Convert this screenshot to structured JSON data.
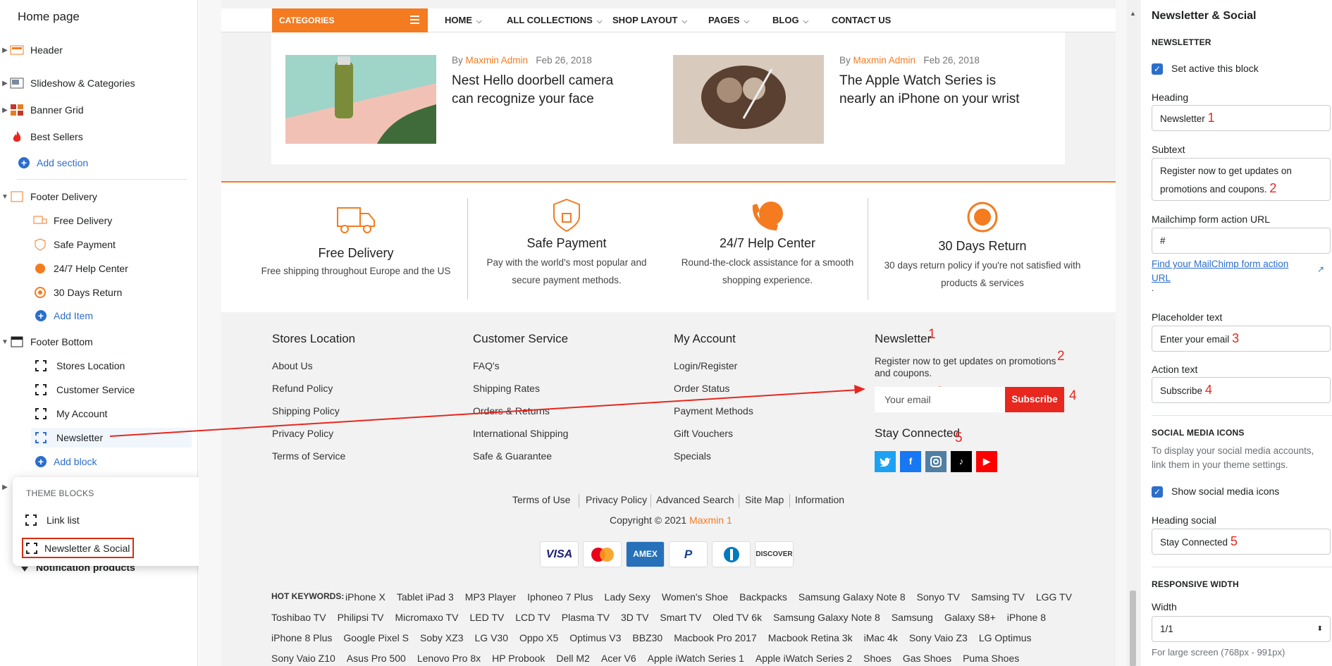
{
  "sidebar": {
    "title": "Home page",
    "sections": [
      {
        "label": "Header"
      },
      {
        "label": "Slideshow & Categories"
      },
      {
        "label": "Banner Grid"
      },
      {
        "label": "Best Sellers"
      }
    ],
    "add_section": "Add section",
    "footer_delivery": {
      "label": "Footer Delivery",
      "items": [
        "Free Delivery",
        "Safe Payment",
        "24/7 Help Center",
        "30 Days Return"
      ],
      "add_item": "Add Item"
    },
    "footer_bottom": {
      "label": "Footer Bottom",
      "blocks": [
        "Stores Location",
        "Customer Service",
        "My Account",
        "Newsletter"
      ],
      "add_block": "Add block"
    },
    "hidden_row": "Notification products",
    "popup": {
      "heading": "THEME BLOCKS",
      "items": [
        "Link list",
        "Newsletter & Social"
      ]
    }
  },
  "preview": {
    "nav": {
      "categories": "CATEGORIES",
      "items": [
        "HOME",
        "ALL COLLECTIONS",
        "SHOP LAYOUT",
        "PAGES",
        "BLOG",
        "CONTACT US"
      ]
    },
    "posts": [
      {
        "by": "By",
        "author": "Maxmin Admin",
        "date": "Feb 26, 2018",
        "title": "Nest Hello doorbell camera can recognize your face"
      },
      {
        "by": "By",
        "author": "Maxmin Admin",
        "date": "Feb 26, 2018",
        "title": "The Apple Watch Series is nearly an iPhone on your wrist"
      }
    ],
    "features": [
      {
        "title": "Free Delivery",
        "desc": "Free shipping throughout Europe and the US"
      },
      {
        "title": "Safe Payment",
        "desc": "Pay with the world's most popular and secure payment methods."
      },
      {
        "title": "24/7 Help Center",
        "desc": "Round-the-clock assistance for a smooth shopping experience."
      },
      {
        "title": "30 Days Return",
        "desc": "30 days return policy if you're not satisfied with products & services"
      }
    ],
    "footer": {
      "stores": {
        "heading": "Stores Location",
        "links": [
          "About Us",
          "Refund Policy",
          "Shipping Policy",
          "Privacy Policy",
          "Terms of Service"
        ]
      },
      "service": {
        "heading": "Customer Service",
        "links": [
          "FAQ's",
          "Shipping Rates",
          "Orders & Returns",
          "International Shipping",
          "Safe & Guarantee"
        ]
      },
      "account": {
        "heading": "My Account",
        "links": [
          "Login/Register",
          "Order Status",
          "Payment Methods",
          "Gift Vouchers",
          "Specials"
        ]
      },
      "newsletter": {
        "heading": "Newsletter",
        "subtext": "Register now to get updates on promotions and coupons.",
        "placeholder": "Your email",
        "button": "Subscribe",
        "social_heading": "Stay Connected"
      },
      "bottom_links": [
        "Terms of Use",
        "Privacy Policy",
        "Advanced Search",
        "Site Map",
        "Information"
      ],
      "copyright_prefix": "Copyright © 2021",
      "copyright_brand": "Maxmin 1",
      "payments": [
        "VISA",
        "Mastercard",
        "AMEX",
        "PayPal",
        "Diners",
        "DISCOVER"
      ],
      "hot_keywords_label": "HOT KEYWORDS:",
      "keywords": [
        [
          "iPhone X",
          "Tablet iPad 3",
          "MP3 Player",
          "Iphoneo 7 Plus",
          "Lady Sexy",
          "Women's Shoe",
          "Backpacks",
          "Samsung Galaxy Note 8",
          "Sonyo TV",
          "Samsing TV",
          "LGG TV"
        ],
        [
          "Toshibao TV",
          "Philipsi TV",
          "Micromaxo TV",
          "LED TV",
          "LCD TV",
          "Plasma TV",
          "3D TV",
          "Smart TV",
          "Oled TV 6k",
          "Samsung Galaxy Note 8",
          "Samsung",
          "Galaxy S8+",
          "iPhone 8"
        ],
        [
          "iPhone 8 Plus",
          "Google Pixel S",
          "Soby XZ3",
          "LG V30",
          "Oppo X5",
          "Optimus V3",
          "BBZ30",
          "Macbook Pro 2017",
          "Macbook Retina 3k",
          "iMac 4k",
          "Sony Vaio Z3",
          "LG Optimus"
        ],
        [
          "Sony Vaio Z10",
          "Asus Pro 500",
          "Lenovo Pro 8x",
          "HP Probook",
          "Dell M2",
          "Acer V6",
          "Apple iWatch Series 1",
          "Apple iWatch Series 2",
          "Shoes",
          "Gas Shoes",
          "Puma Shoes"
        ]
      ]
    },
    "annotations": [
      "1",
      "2",
      "3",
      "4",
      "5"
    ]
  },
  "settings": {
    "title": "Newsletter & Social",
    "newsletter_section": "NEWSLETTER",
    "set_active": "Set active this block",
    "heading_label": "Heading",
    "heading_value": "Newsletter",
    "subtext_label": "Subtext",
    "subtext_value": "Register now to get updates on promotions and coupons.",
    "mailchimp_label": "Mailchimp form action URL",
    "mailchimp_value": "#",
    "mailchimp_link": "Find your MailChimp form action URL",
    "mailchimp_dot": ".",
    "placeholder_label": "Placeholder text",
    "placeholder_value": "Enter your email",
    "action_label": "Action text",
    "action_value": "Subscribe",
    "social_section": "SOCIAL MEDIA ICONS",
    "social_help": "To display your social media accounts, link them in your theme settings.",
    "show_social": "Show social media icons",
    "heading_social_label": "Heading social",
    "heading_social_value": "Stay Connected",
    "responsive_section": "RESPONSIVE WIDTH",
    "width_label": "Width",
    "width_value": "1/1",
    "width_help": "For large screen (768px - 991px)"
  },
  "colors": {
    "accent": "#f47b20",
    "link": "#2c6ecb",
    "annotation": "#e8271f"
  }
}
